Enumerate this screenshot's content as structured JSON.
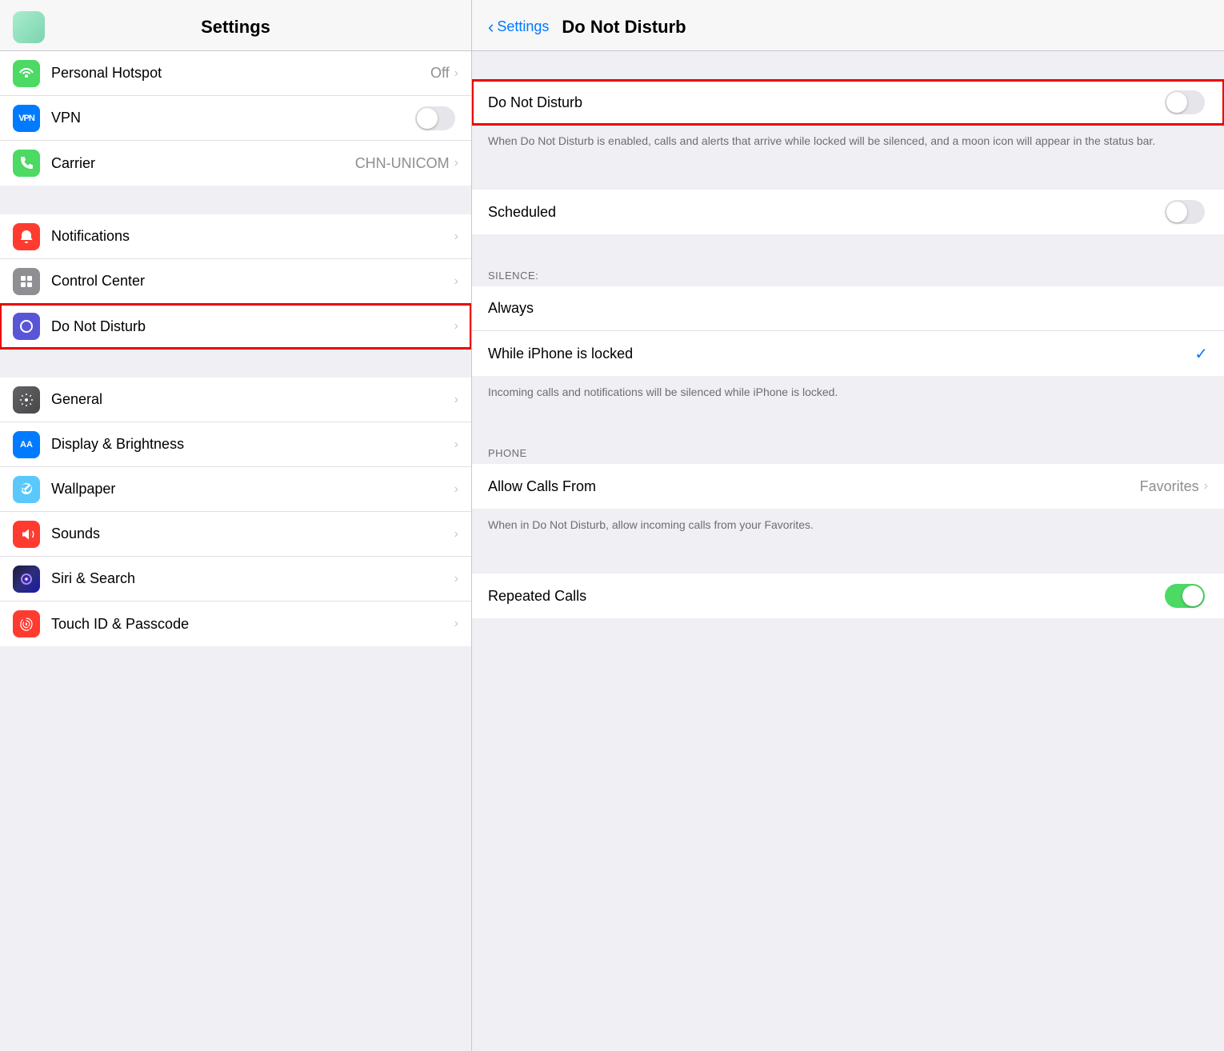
{
  "leftPanel": {
    "title": "Settings",
    "headerIconColor": "#a8edcc",
    "groups": [
      {
        "items": [
          {
            "id": "hotspot",
            "label": "Personal Hotspot",
            "value": "Off",
            "hasChevron": true,
            "iconBg": "bg-green",
            "iconSymbol": "⛓",
            "iconType": "hotspot"
          },
          {
            "id": "vpn",
            "label": "VPN",
            "hasToggle": true,
            "toggleOn": false,
            "iconBg": "bg-blue",
            "iconSymbol": "VPN",
            "iconType": "vpn"
          },
          {
            "id": "carrier",
            "label": "Carrier",
            "value": "CHN-UNICOM",
            "hasChevron": true,
            "iconBg": "bg-phone-green",
            "iconSymbol": "📞",
            "iconType": "carrier"
          }
        ]
      },
      {
        "items": [
          {
            "id": "notifications",
            "label": "Notifications",
            "hasChevron": true,
            "iconBg": "bg-red",
            "iconSymbol": "🔔",
            "iconType": "notifications"
          },
          {
            "id": "controlcenter",
            "label": "Control Center",
            "hasChevron": true,
            "iconBg": "bg-gray",
            "iconSymbol": "⊞",
            "iconType": "controlcenter"
          },
          {
            "id": "donotdisturb",
            "label": "Do Not Disturb",
            "hasChevron": true,
            "iconBg": "bg-purple",
            "iconSymbol": "🌙",
            "iconType": "donotdisturb",
            "highlighted": true
          }
        ]
      },
      {
        "items": [
          {
            "id": "general",
            "label": "General",
            "hasChevron": true,
            "iconBg": "bg-dark-gray",
            "iconSymbol": "⚙",
            "iconType": "general"
          },
          {
            "id": "display",
            "label": "Display & Brightness",
            "hasChevron": true,
            "iconBg": "bg-blue-aa",
            "iconSymbol": "AA",
            "iconType": "display"
          },
          {
            "id": "wallpaper",
            "label": "Wallpaper",
            "hasChevron": true,
            "iconBg": "bg-teal",
            "iconSymbol": "❋",
            "iconType": "wallpaper"
          },
          {
            "id": "sounds",
            "label": "Sounds",
            "hasChevron": true,
            "iconBg": "bg-pink-red",
            "iconSymbol": "🔊",
            "iconType": "sounds"
          },
          {
            "id": "siri",
            "label": "Siri & Search",
            "hasChevron": true,
            "iconBg": "bg-siri",
            "iconSymbol": "◉",
            "iconType": "siri"
          },
          {
            "id": "touchid",
            "label": "Touch ID & Passcode",
            "hasChevron": true,
            "iconBg": "bg-touch",
            "iconSymbol": "◎",
            "iconType": "touchid"
          }
        ]
      }
    ]
  },
  "rightPanel": {
    "backLabel": "Settings",
    "title": "Do Not Disturb",
    "sections": [
      {
        "type": "spacer"
      },
      {
        "type": "main-toggle",
        "label": "Do Not Disturb",
        "toggleOn": false,
        "highlighted": true
      },
      {
        "type": "description",
        "text": "When Do Not Disturb is enabled, calls and alerts that arrive while locked will be silenced, and a moon icon will appear in the status bar."
      },
      {
        "type": "spacer"
      },
      {
        "type": "row",
        "label": "Scheduled",
        "hasToggle": true,
        "toggleOn": false
      },
      {
        "type": "spacer"
      },
      {
        "type": "section-header",
        "text": "SILENCE:"
      },
      {
        "type": "row",
        "label": "Always",
        "hasChevron": false
      },
      {
        "type": "row",
        "label": "While iPhone is locked",
        "hasCheck": true
      },
      {
        "type": "description",
        "text": "Incoming calls and notifications will be silenced while iPhone is locked."
      },
      {
        "type": "spacer"
      },
      {
        "type": "section-header",
        "text": "PHONE"
      },
      {
        "type": "row",
        "label": "Allow Calls From",
        "value": "Favorites",
        "hasChevron": true
      },
      {
        "type": "description",
        "text": "When in Do Not Disturb, allow incoming calls from your Favorites."
      },
      {
        "type": "spacer"
      },
      {
        "type": "row",
        "label": "Repeated Calls",
        "hasToggle": true,
        "toggleOn": true
      }
    ]
  }
}
